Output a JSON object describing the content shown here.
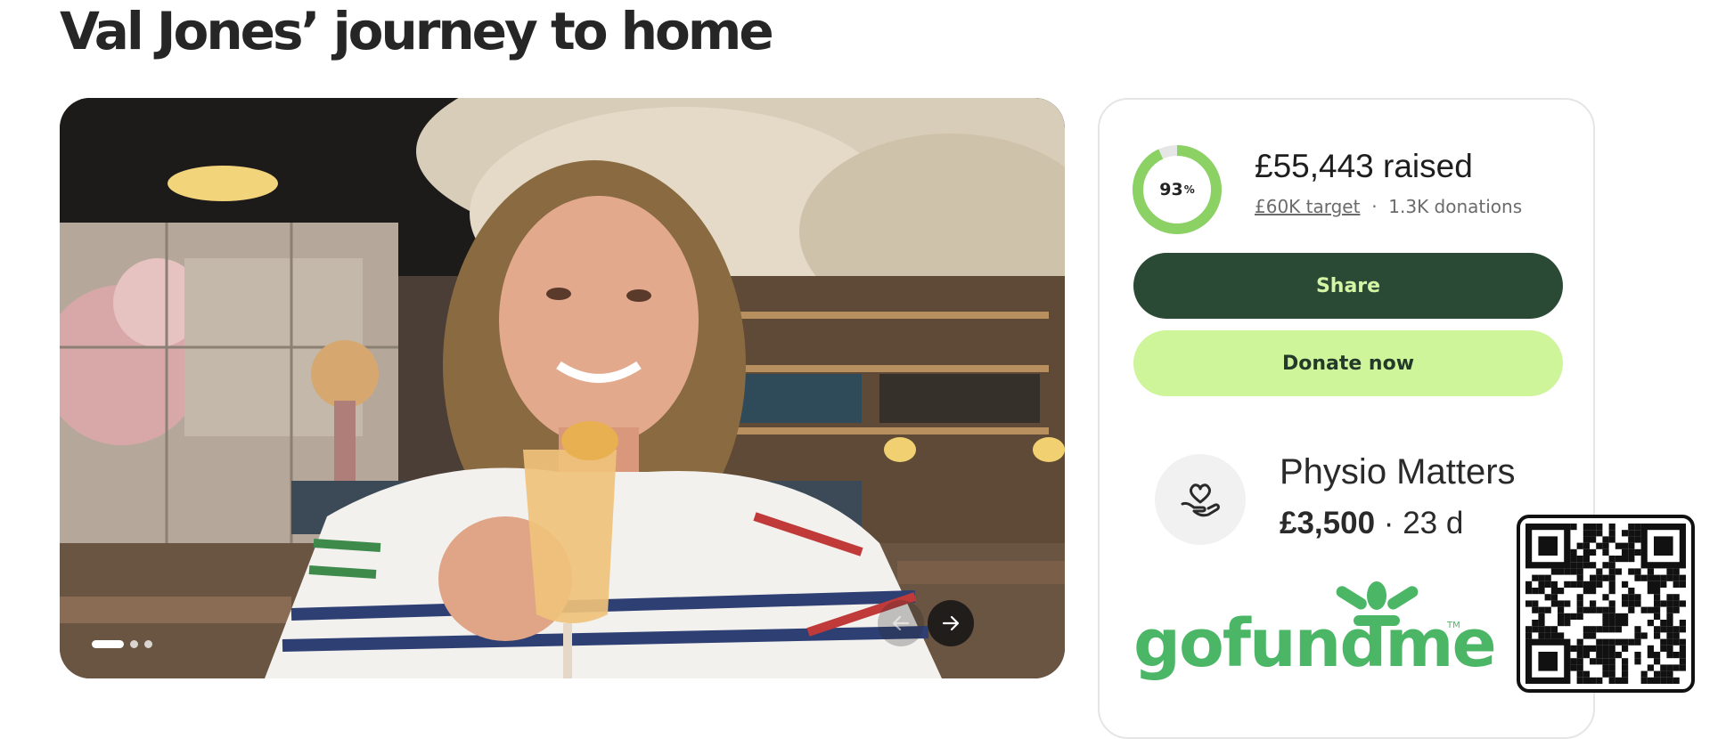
{
  "page": {
    "title": "Val Jones’ journey to home"
  },
  "gallery": {
    "slide_count": 3,
    "active_slide": 1,
    "prev_icon": "arrow-left-icon",
    "next_icon": "arrow-right-icon"
  },
  "fundraiser": {
    "progress_percent": 93,
    "percent_label": "93",
    "percent_sign": "%",
    "raised": "£55,443 raised",
    "target": "£60K target",
    "separator": "·",
    "donations": "1.3K donations",
    "share_label": "Share",
    "donate_label": "Donate now"
  },
  "top_donation": {
    "icon": "heart-in-hand-icon",
    "name": "Physio Matters",
    "amount": "£3,500",
    "separator": "·",
    "time_ago": "23 d"
  },
  "brand": {
    "logo_text": "gofundme",
    "trademark": "TM",
    "color": "#4cb667"
  },
  "colors": {
    "share_bg": "#2a4a36",
    "share_text": "#d3f5a4",
    "donate_bg": "#cef59a",
    "donate_text": "#233a2a",
    "ring": "#8cd164"
  }
}
